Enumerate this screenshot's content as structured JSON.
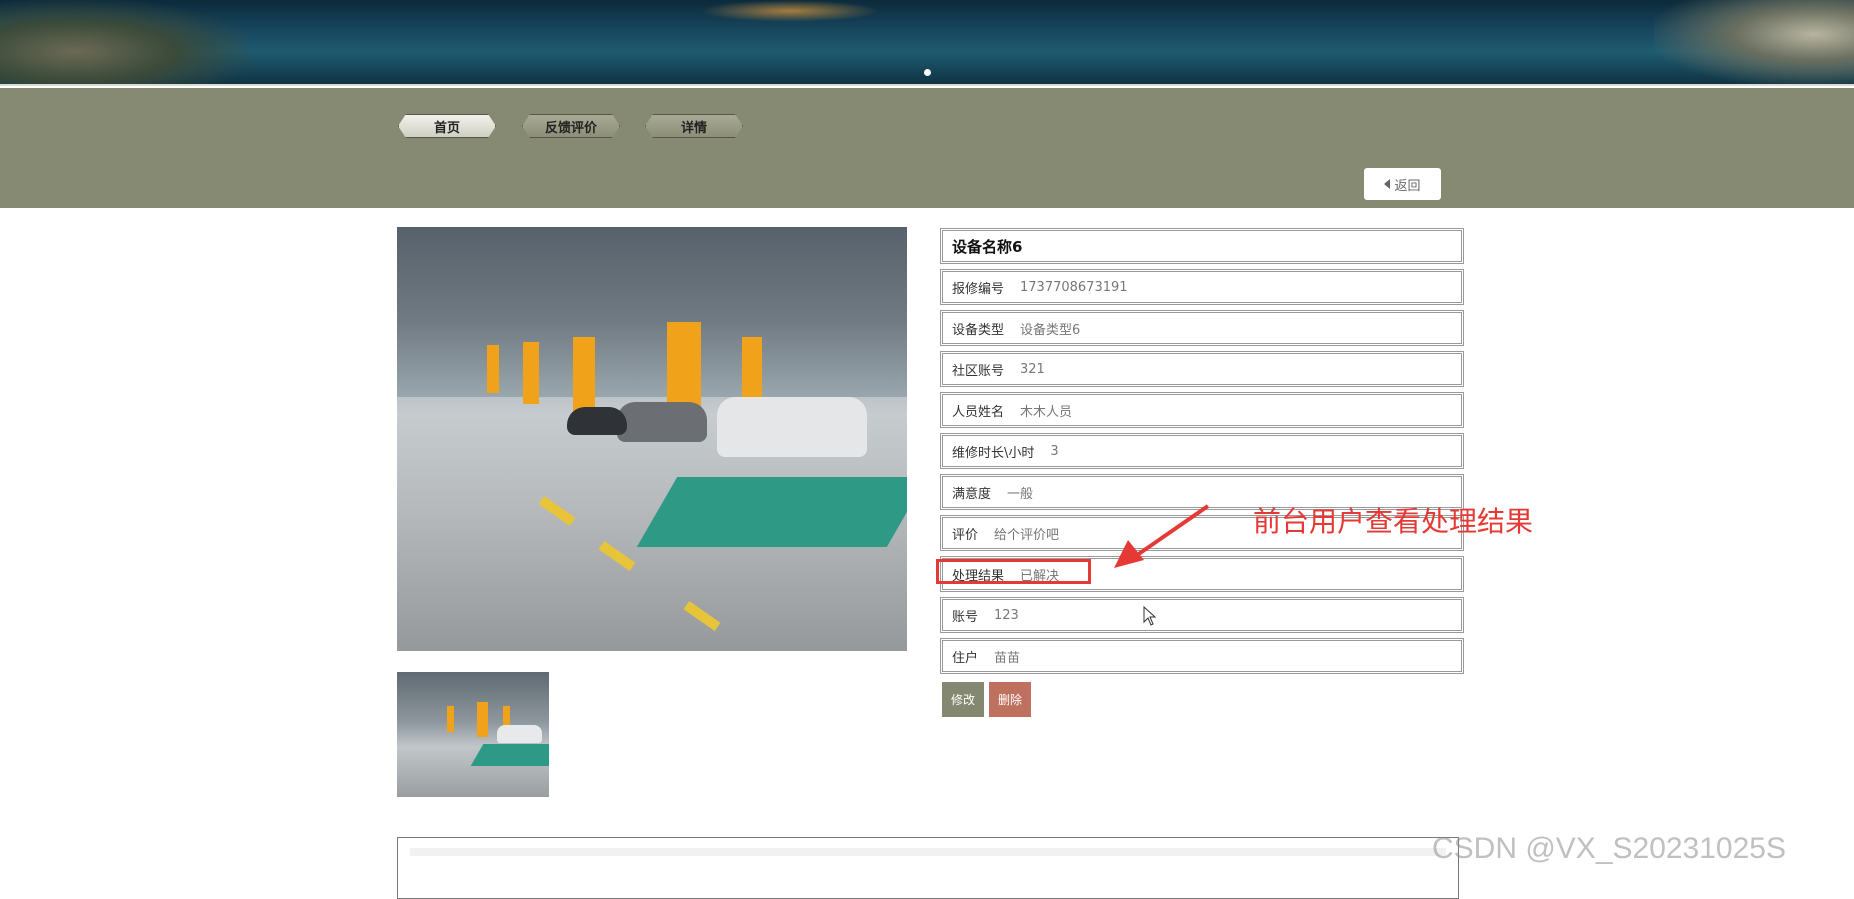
{
  "nav": {
    "tabs": [
      {
        "label": "首页"
      },
      {
        "label": "反馈评价"
      },
      {
        "label": "详情"
      }
    ],
    "back_label": "返回"
  },
  "detail": {
    "title": "设备名称6",
    "fields": [
      {
        "label": "报修编号",
        "value": "1737708673191"
      },
      {
        "label": "设备类型",
        "value": "设备类型6"
      },
      {
        "label": "社区账号",
        "value": "321"
      },
      {
        "label": "人员姓名",
        "value": "木木人员"
      },
      {
        "label": "维修时长\\小时",
        "value": "3"
      },
      {
        "label": "满意度",
        "value": "一般"
      },
      {
        "label": "评价",
        "value": "给个评价吧"
      },
      {
        "label": "处理结果",
        "value": "已解决"
      },
      {
        "label": "账号",
        "value": "123"
      },
      {
        "label": "住户",
        "value": "苗苗"
      }
    ],
    "edit_label": "修改",
    "delete_label": "删除"
  },
  "annotation": {
    "text": "前台用户查看处理结果",
    "color": "#e53935"
  },
  "watermark": "CSDN @VX_S20231025S",
  "colors": {
    "navbar": "#878a73",
    "edit_button": "#858870",
    "delete_button": "#c0705e"
  }
}
